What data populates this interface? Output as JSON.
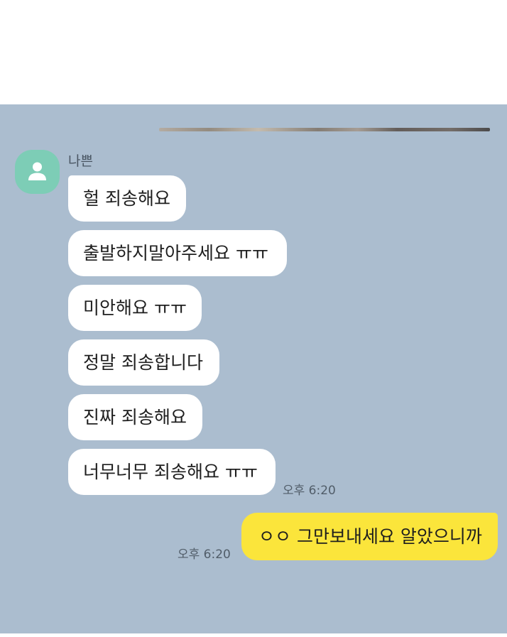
{
  "chat": {
    "sender_name": "나쁜",
    "incoming_messages": [
      "헐 죄송해요",
      "출발하지말아주세요 ㅠㅠ",
      "미안해요 ㅠㅠ",
      "정말 죄송합니다",
      "진짜 죄송해요",
      "너무너무 죄송해요 ㅠㅠ"
    ],
    "incoming_time": "오후 6:20",
    "outgoing_message": "ㅇㅇ 그만보내세요 알았으니까",
    "outgoing_time": "오후 6:20"
  },
  "colors": {
    "chat_background": "#abbdcf",
    "incoming_bubble": "#ffffff",
    "outgoing_bubble": "#fbe53b",
    "avatar": "#7dcdb6"
  },
  "icons": {
    "avatar": "default-profile-icon"
  }
}
